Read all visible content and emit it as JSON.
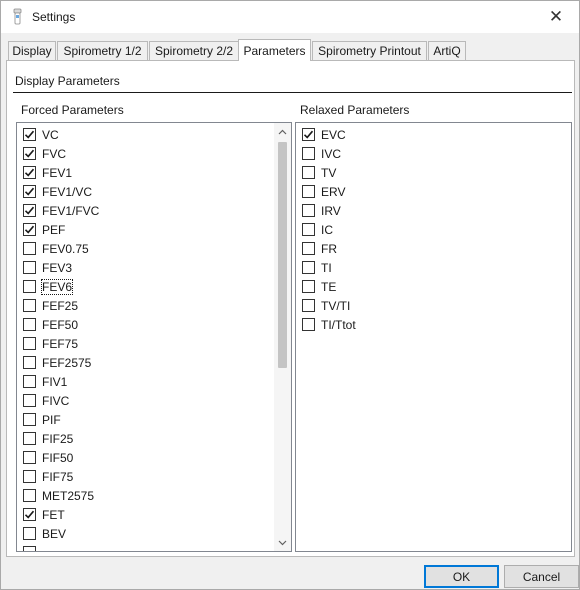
{
  "window": {
    "title": "Settings",
    "icon": "app-icon",
    "close_glyph": "✕"
  },
  "tabs": [
    {
      "label": "Display",
      "active": false
    },
    {
      "label": "Spirometry 1/2",
      "active": false
    },
    {
      "label": "Spirometry 2/2",
      "active": false
    },
    {
      "label": "Parameters",
      "active": true
    },
    {
      "label": "Spirometry Printout",
      "active": false
    },
    {
      "label": "ArtiQ",
      "active": false
    }
  ],
  "section_title": "Display Parameters",
  "forced": {
    "label": "Forced Parameters",
    "items": [
      {
        "label": "VC",
        "checked": true
      },
      {
        "label": "FVC",
        "checked": true
      },
      {
        "label": "FEV1",
        "checked": true
      },
      {
        "label": "FEV1/VC",
        "checked": true
      },
      {
        "label": "FEV1/FVC",
        "checked": true
      },
      {
        "label": "PEF",
        "checked": true
      },
      {
        "label": "FEV0.75",
        "checked": false
      },
      {
        "label": "FEV3",
        "checked": false
      },
      {
        "label": "FEV6",
        "checked": false,
        "focused": true
      },
      {
        "label": "FEF25",
        "checked": false
      },
      {
        "label": "FEF50",
        "checked": false
      },
      {
        "label": "FEF75",
        "checked": false
      },
      {
        "label": "FEF2575",
        "checked": false
      },
      {
        "label": "FIV1",
        "checked": false
      },
      {
        "label": "FIVC",
        "checked": false
      },
      {
        "label": "PIF",
        "checked": false
      },
      {
        "label": "FIF25",
        "checked": false
      },
      {
        "label": "FIF50",
        "checked": false
      },
      {
        "label": "FIF75",
        "checked": false
      },
      {
        "label": "MET2575",
        "checked": false
      },
      {
        "label": "FET",
        "checked": true
      },
      {
        "label": "BEV",
        "checked": false
      },
      {
        "label": "",
        "checked": false
      }
    ],
    "scroll_position": 0.0
  },
  "relaxed": {
    "label": "Relaxed Parameters",
    "items": [
      {
        "label": "EVC",
        "checked": true
      },
      {
        "label": "IVC",
        "checked": false
      },
      {
        "label": "TV",
        "checked": false
      },
      {
        "label": "ERV",
        "checked": false
      },
      {
        "label": "IRV",
        "checked": false
      },
      {
        "label": "IC",
        "checked": false
      },
      {
        "label": "FR",
        "checked": false
      },
      {
        "label": "TI",
        "checked": false
      },
      {
        "label": "TE",
        "checked": false
      },
      {
        "label": "TV/TI",
        "checked": false
      },
      {
        "label": "TI/Ttot",
        "checked": false
      }
    ]
  },
  "buttons": {
    "ok": "OK",
    "cancel": "Cancel"
  },
  "colors": {
    "accent": "#0078d7",
    "checkmark": "#1a1a1a"
  }
}
